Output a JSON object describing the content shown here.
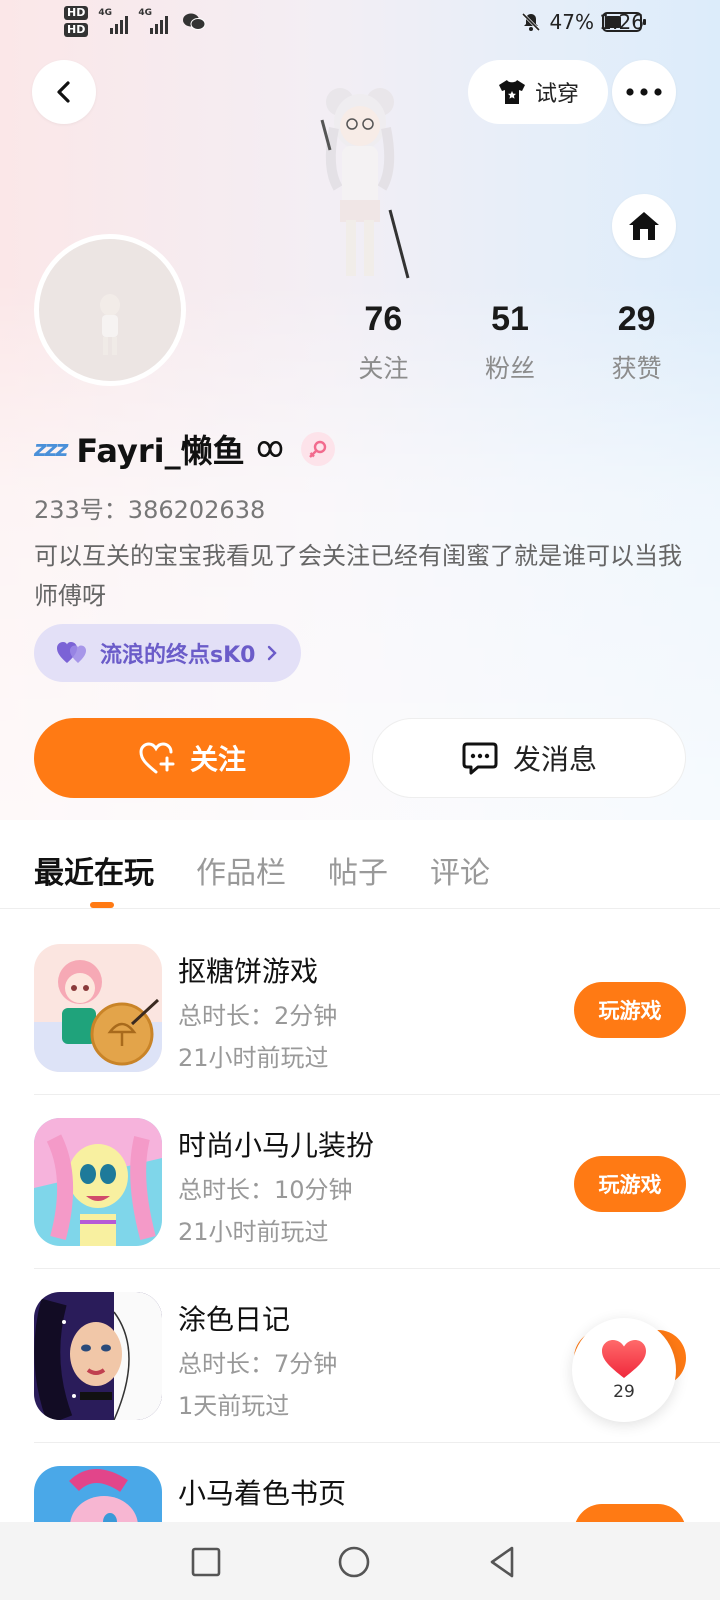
{
  "status_bar": {
    "hd1": "HD",
    "hd2": "HD",
    "sig1_label": "4G",
    "sig2_label": "4G",
    "battery_pct": "47%",
    "battery_level": 0.47,
    "time": "1:26"
  },
  "header": {
    "back_icon": "chevron-left-icon",
    "tryon_label": "试穿",
    "more_icon": "more-dots-icon",
    "home_icon": "home-icon"
  },
  "profile": {
    "stats": [
      {
        "value": "76",
        "label": "关注"
      },
      {
        "value": "51",
        "label": "粉丝"
      },
      {
        "value": "29",
        "label": "获赞"
      }
    ],
    "zzz": "zzz",
    "username": "Fayri_懒鱼",
    "uid": "233号：386202638",
    "bio": "可以互关的宝宝我看见了会关注已经有闺蜜了就是谁可以当我师傅呀",
    "cp_tag": "流浪的终点sK0"
  },
  "actions": {
    "follow_label": "关注",
    "message_label": "发消息"
  },
  "tabs": [
    {
      "label": "最近在玩",
      "active": true
    },
    {
      "label": "作品栏",
      "active": false
    },
    {
      "label": "帖子",
      "active": false
    },
    {
      "label": "评论",
      "active": false
    }
  ],
  "games": [
    {
      "title": "抠糖饼游戏",
      "duration": "总时长：2分钟",
      "last_played": "21小时前玩过",
      "button": "玩游戏"
    },
    {
      "title": "时尚小马儿装扮",
      "duration": "总时长：10分钟",
      "last_played": "21小时前玩过",
      "button": "玩游戏"
    },
    {
      "title": "涂色日记",
      "duration": "总时长：7分钟",
      "last_played": "1天前玩过",
      "button": "玩游戏"
    },
    {
      "title": "小马着色书页",
      "duration": "",
      "last_played": "",
      "button": ""
    }
  ],
  "like_float": {
    "icon": "heart-icon",
    "count": "29"
  },
  "colors": {
    "accent": "#ff7a14",
    "tag_bg": "#e3e0f7",
    "tag_text": "#6b5cc9"
  }
}
